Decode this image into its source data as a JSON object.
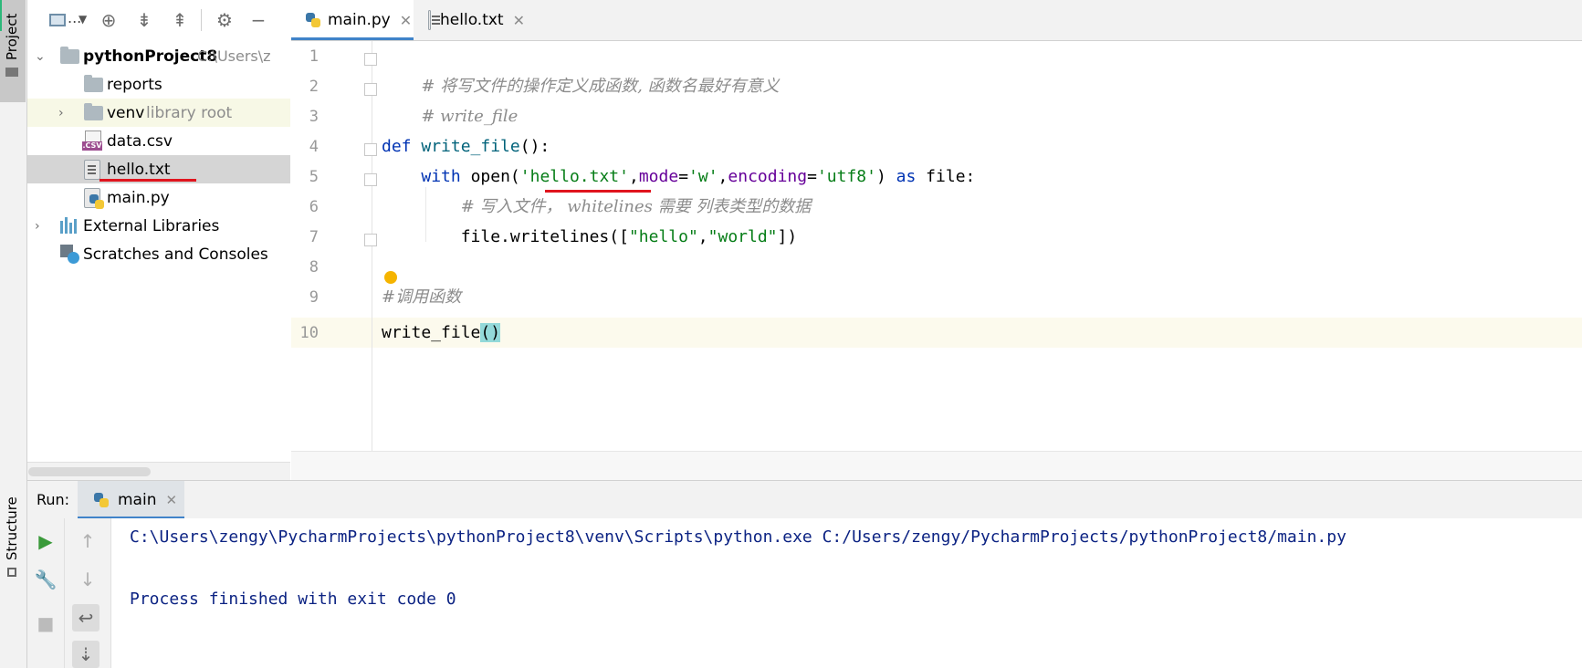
{
  "stripe": {
    "project_label": "Project",
    "structure_label": "Structure"
  },
  "project_toolbar": {
    "view_label": "..."
  },
  "project_tree": {
    "root": {
      "name": "pythonProject8",
      "path": "C:\\Users\\z"
    },
    "items": [
      {
        "name": "reports"
      },
      {
        "name": "venv",
        "hint": "library root"
      },
      {
        "name": "data.csv"
      },
      {
        "name": "hello.txt"
      },
      {
        "name": "main.py"
      }
    ],
    "external_libraries": "External Libraries",
    "scratches": "Scratches and Consoles"
  },
  "tabs": [
    {
      "label": "main.py"
    },
    {
      "label": "hello.txt"
    }
  ],
  "editor": {
    "line_numbers": [
      "1",
      "2",
      "3",
      "4",
      "5",
      "6",
      "7",
      "8",
      "9",
      "10"
    ],
    "lines": {
      "l1_comment": "# 将写文件的操作定义成函数, 函数名最好有意义",
      "l2_comment": "# write_file",
      "l4_def": "def",
      "l4_name": "write_file",
      "l4_rest": "():",
      "l5_with": "with",
      "l5_open": "open",
      "l5_p1": "(",
      "l5_str1": "'hello.txt'",
      "l5_c1": ",",
      "l5_mode": "mode",
      "l5_eq1": "=",
      "l5_str2": "'w'",
      "l5_c2": ",",
      "l5_enc": "encoding",
      "l5_eq2": "=",
      "l5_str3": "'utf8'",
      "l5_p2": ") ",
      "l5_as": "as",
      "l5_tail": " file:",
      "l6_comment": "# 写入文件， whitelines 需要 列表类型的数据",
      "l7_pre": "file.writelines([",
      "l7_s1": "\"hello\"",
      "l7_c": ",",
      "l7_s2": "\"world\"",
      "l7_post": "])",
      "l9_comment": "#调用函数",
      "l10_call": "write_file",
      "l10_parens": "()"
    }
  },
  "run": {
    "title": "Run:",
    "tab": "main",
    "console": [
      "C:\\Users\\zengy\\PycharmProjects\\pythonProject8\\venv\\Scripts\\python.exe C:/Users/zengy/PycharmProjects/pythonProject8/main.py",
      "",
      "Process finished with exit code 0"
    ]
  },
  "colors": {
    "accent": "#4083c9",
    "keyword": "#0033b3",
    "string": "#067d17",
    "comment": "#8c8c8c",
    "annotation_red": "#e0141e"
  }
}
